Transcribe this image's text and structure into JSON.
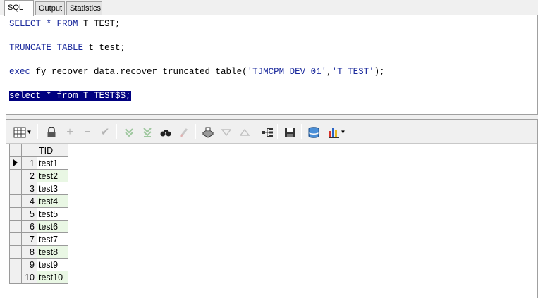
{
  "tabs": [
    {
      "label": "SQL"
    },
    {
      "label": "Output"
    },
    {
      "label": "Statistics"
    }
  ],
  "editor": {
    "line1": {
      "kw": "SELECT * FROM",
      "rest": " T_TEST;"
    },
    "line2": {
      "kw": "TRUNCATE TABLE",
      "rest": " t_test;"
    },
    "line3": {
      "kw": "exec",
      "mid": " fy_recover_data.recover_truncated_table(",
      "s1": "'TJMCPM_DEV_01'",
      "comma": ",",
      "s2": "'T_TEST'",
      "end": ");"
    },
    "line4": {
      "text": "select * from T_TEST$$;"
    }
  },
  "toolbar": {
    "icons": [
      "grid-layout-icon",
      "lock-icon",
      "add-record-icon",
      "delete-record-icon",
      "post-changes-icon",
      "next-page-icon",
      "last-page-icon",
      "find-icon",
      "clear-icon",
      "print-icon",
      "filter-icon",
      "sort-icon",
      "query-tree-icon",
      "save-icon",
      "export-icon",
      "chart-icon"
    ]
  },
  "grid": {
    "header": "TID",
    "rows": [
      {
        "num": "1",
        "tid": "test1"
      },
      {
        "num": "2",
        "tid": "test2"
      },
      {
        "num": "3",
        "tid": "test3"
      },
      {
        "num": "4",
        "tid": "test4"
      },
      {
        "num": "5",
        "tid": "test5"
      },
      {
        "num": "6",
        "tid": "test6"
      },
      {
        "num": "7",
        "tid": "test7"
      },
      {
        "num": "8",
        "tid": "test8"
      },
      {
        "num": "9",
        "tid": "test9"
      },
      {
        "num": "10",
        "tid": "test10"
      }
    ]
  },
  "colors": {
    "keyword": "#1b2a9c",
    "selection": "#000080",
    "row_alt": "#e9f7e4"
  }
}
